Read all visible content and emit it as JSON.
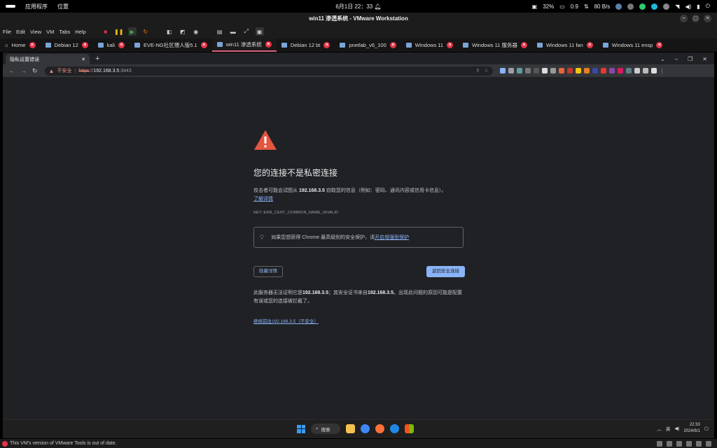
{
  "gnome": {
    "apps": "应用程序",
    "places": "位置",
    "datetime": "6月1日  22：33",
    "cpu": "32%",
    "mem": "0.9",
    "net": "80 B/s"
  },
  "vmware": {
    "window_title": "win11 渗透系统 - VMware Workstation",
    "menu": [
      "File",
      "Edit",
      "View",
      "VM",
      "Tabs",
      "Help"
    ],
    "tabs": [
      {
        "label": "Home"
      },
      {
        "label": "Debian 12"
      },
      {
        "label": "kali"
      },
      {
        "label": "EVE-NG社区猥人版5.1"
      },
      {
        "label": "win11 渗透系统",
        "active": true
      },
      {
        "label": "Debian 12 bt"
      },
      {
        "label": "pnetlab_v6_100"
      },
      {
        "label": "Windows 11"
      },
      {
        "label": "Windows 11 服务器"
      },
      {
        "label": "Windows 11 fan"
      },
      {
        "label": "Windows 11 ensp"
      }
    ],
    "status_text": "This VM's version of VMware Tools is out of date."
  },
  "chrome": {
    "tab_title": "隐私设置错误",
    "omnibox": {
      "security": "不安全",
      "scheme": "https",
      "sep": "://",
      "host": "192.168.3.5",
      "port": ":3443"
    }
  },
  "page": {
    "heading": "您的连接不是私密连接",
    "desc_prefix": "攻击者可能会试图从 ",
    "desc_host": "192.168.3.5",
    "desc_suffix": " 窃取您的信息（例如：密码、通讯内容或信用卡信息）。",
    "learn_more": "了解详情",
    "error_code": "NET::ERR_CERT_COMMON_NAME_INVALID",
    "enhanced_text": "如果您想获得 Chrome 最高级别的安全保护，请",
    "enhanced_link": "开启增强型保护",
    "btn_details": "隐藏详情",
    "btn_back": "返回安全连接",
    "detail_a": "此服务器无法证明它是",
    "detail_host1": "192.168.3.5",
    "detail_b": "；其安全证书来自",
    "detail_host2": "192.168.3.5",
    "detail_c": "。出现此问题的原因可能是配置有误或您的连接被拦截了。",
    "proceed": "继续前往192.168.3.5（不安全）"
  },
  "taskbar": {
    "search": "搜索",
    "ime": "英",
    "time": "22:33",
    "date": "2024/6/1"
  }
}
